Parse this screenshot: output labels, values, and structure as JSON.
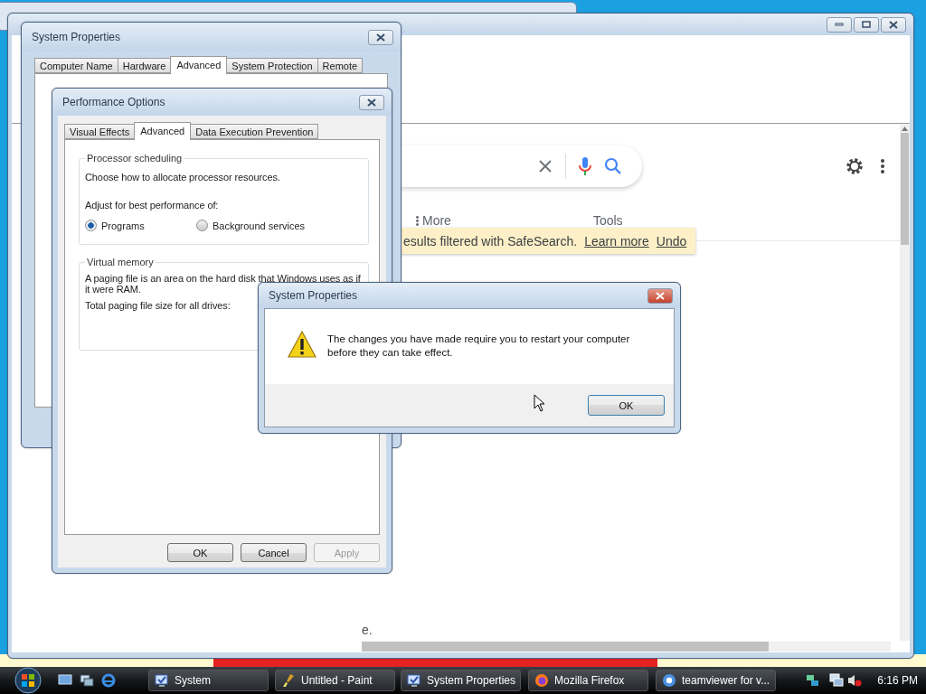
{
  "browser": {
    "more_label": "More",
    "tools_label": "Tools",
    "safesearch": {
      "message": "esults filtered with SafeSearch.",
      "links": [
        "Learn more",
        "Undo"
      ]
    },
    "page_text": "e."
  },
  "system_properties": {
    "title": "System Properties",
    "tabs": [
      {
        "label": "Computer Name",
        "selected": false
      },
      {
        "label": "Hardware",
        "selected": false
      },
      {
        "label": "Advanced",
        "selected": true
      },
      {
        "label": "System Protection",
        "selected": false
      },
      {
        "label": "Remote",
        "selected": false
      }
    ]
  },
  "performance_options": {
    "title": "Performance Options",
    "tabs": [
      {
        "label": "Visual Effects",
        "selected": false
      },
      {
        "label": "Advanced",
        "selected": true
      },
      {
        "label": "Data Execution Prevention",
        "selected": false
      }
    ],
    "processor_scheduling": {
      "legend": "Processor scheduling",
      "description": "Choose how to allocate processor resources.",
      "prompt": "Adjust for best performance of:",
      "options": [
        {
          "label": "Programs",
          "selected": true
        },
        {
          "label": "Background services",
          "selected": false
        }
      ]
    },
    "virtual_memory": {
      "legend": "Virtual memory",
      "description": "A paging file is an area on the hard disk that Windows uses as if it were RAM.",
      "total_label": "Total paging file size for all drives:"
    },
    "buttons": [
      {
        "label": "OK",
        "disabled": false
      },
      {
        "label": "Cancel",
        "disabled": false
      },
      {
        "label": "Apply",
        "disabled": true
      }
    ]
  },
  "message_box": {
    "title": "System Properties",
    "message": "The changes you have made require you to restart your computer before they can take effect.",
    "buttons": [
      "OK"
    ]
  },
  "taskbar": {
    "tasks": [
      {
        "label": "System",
        "kind": "system"
      },
      {
        "label": "Untitled - Paint",
        "kind": "paint"
      },
      {
        "label": "System Properties",
        "kind": "system"
      },
      {
        "label": "Mozilla Firefox",
        "kind": "firefox"
      },
      {
        "label": "teamviewer for v...",
        "kind": "chrome"
      }
    ],
    "clock": "6:16 PM"
  }
}
